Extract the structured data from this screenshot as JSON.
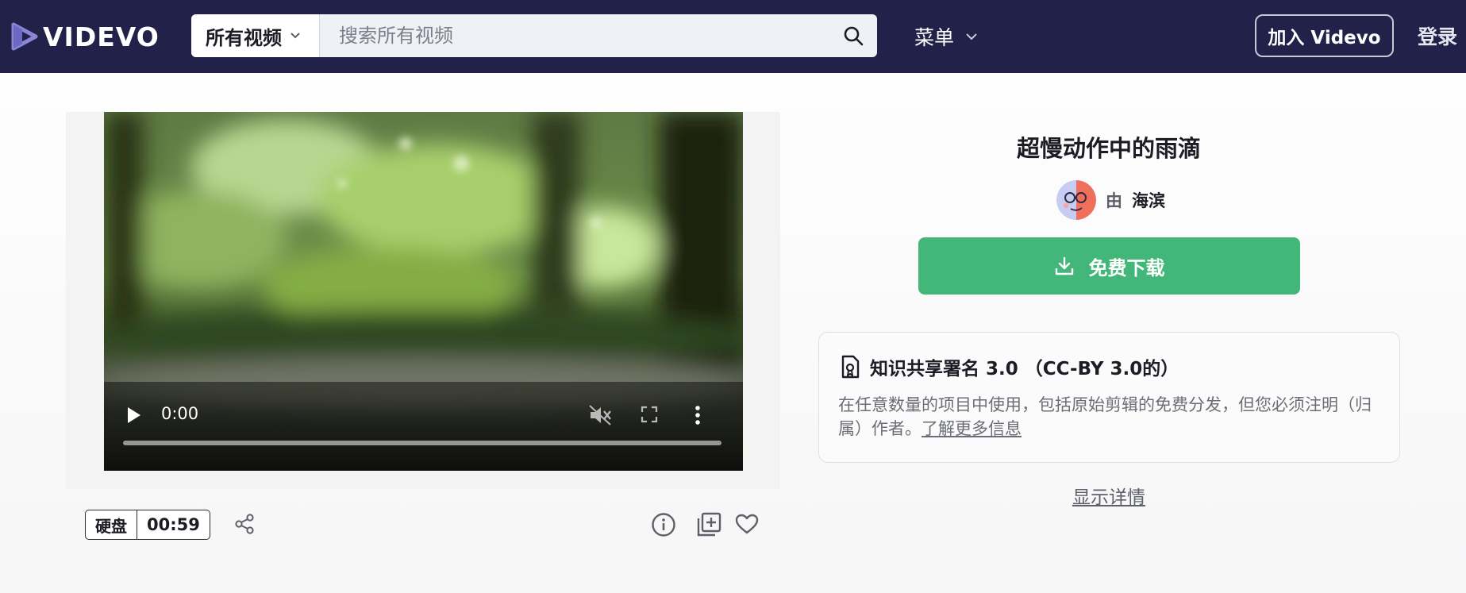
{
  "header": {
    "logo_text": "VIDEVO",
    "search_category": "所有视频",
    "search_placeholder": "搜索所有视频",
    "menu_label": "菜单",
    "join_label": "加入 Videvo",
    "login_label": "登录",
    "bg_color": "#22214a"
  },
  "video": {
    "current_time": "0:00",
    "type_badge": "硬盘",
    "duration": "00:59"
  },
  "details": {
    "title": "超慢动作中的雨滴",
    "author_prefix": "由",
    "author_name": "海滨",
    "download_label": "免费下载",
    "download_color": "#43b679",
    "license_title": "知识共享署名 3.0 （CC-BY 3.0的）",
    "license_desc": "在任意数量的项目中使用，包括原始剪辑的免费分发，但您必须注明（归属）作者。",
    "license_link": "了解更多信息",
    "show_details": "显示详情"
  },
  "icons": [
    "videvo-logo-icon",
    "chevron-down-icon",
    "search-icon",
    "play-icon",
    "mute-icon",
    "fullscreen-icon",
    "more-vertical-icon",
    "share-icon",
    "info-icon",
    "add-to-collection-icon",
    "heart-icon",
    "download-icon",
    "license-icon"
  ]
}
